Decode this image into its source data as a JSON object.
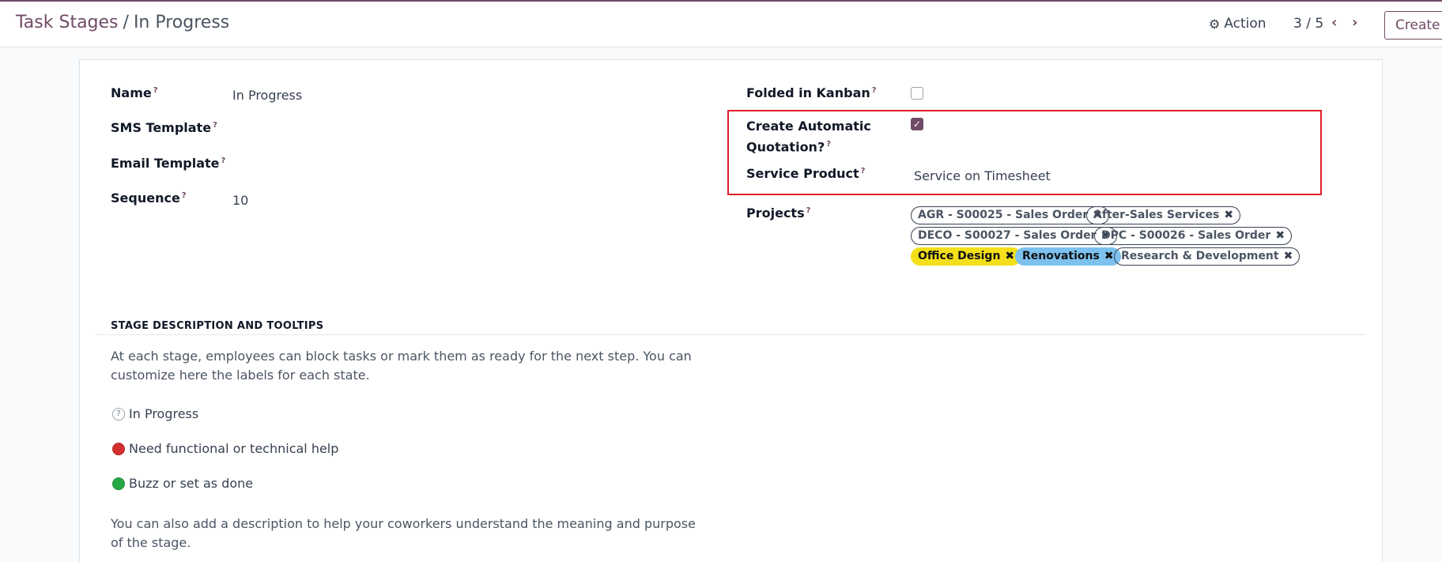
{
  "breadcrumb": {
    "parent": "Task Stages",
    "separator": "/",
    "current": "In Progress"
  },
  "toolbar": {
    "action_label": "Action",
    "pager": "3 / 5",
    "create_label": "Create"
  },
  "fields": {
    "name_label": "Name",
    "name_value": "In Progress",
    "sms_label": "SMS Template",
    "email_label": "Email Template",
    "sequence_label": "Sequence",
    "sequence_value": "10",
    "folded_label": "Folded in Kanban",
    "folded_checked": false,
    "auto_quote_label_1": "Create Automatic",
    "auto_quote_label_2": "Quotation?",
    "auto_quote_checked": true,
    "service_label": "Service Product",
    "service_value": "Service on Timesheet",
    "projects_label": "Projects",
    "help_mark": "?"
  },
  "projects": [
    {
      "label": "AGR - S00025 - Sales Order",
      "color": "none"
    },
    {
      "label": "After-Sales Services",
      "color": "none"
    },
    {
      "label": "DECO - S00027 - Sales Order",
      "color": "none"
    },
    {
      "label": "DPC - S00026 - Sales Order",
      "color": "none"
    },
    {
      "label": "Office Design",
      "color": "#f3e01a"
    },
    {
      "label": "Renovations",
      "color": "#7dc1ef"
    },
    {
      "label": "Research & Development",
      "color": "none"
    }
  ],
  "section": {
    "title": "STAGE DESCRIPTION AND TOOLTIPS",
    "intro": "At each stage, employees can block tasks or mark them as ready for the next step. You can customize here the labels for each state.",
    "states": [
      {
        "label": "In Progress",
        "color": "grey"
      },
      {
        "label": "Need functional or technical help",
        "color": "#d32f2f"
      },
      {
        "label": "Buzz or set as done",
        "color": "#28a745"
      }
    ],
    "outro": "You can also add a description to help your coworkers understand the meaning and purpose of the stage."
  },
  "colors": {
    "brand": "#714b67",
    "highlight": "#e11d2a"
  }
}
